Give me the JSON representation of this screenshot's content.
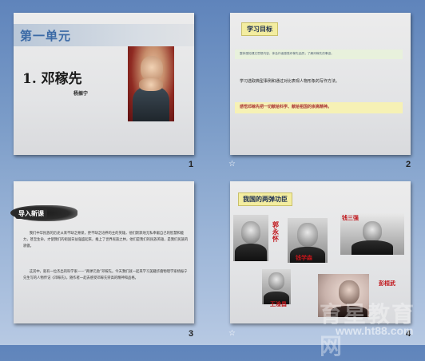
{
  "slides": [
    {
      "number": "1",
      "unit_title": "第一单元",
      "lesson_title": "1. 邓稼先",
      "author": "杨振宁"
    },
    {
      "number": "2",
      "transition_icon": "☆",
      "heading": "学习目标",
      "goals": [
        "整体感知课文思想内容，体会作者感受邓稼先品质；了解邓稼先的事迹。",
        "学习选取典型事例和通过对比表现人物形象的写作方法。",
        "感悟邓稼先把一切献给科学、献给祖国的崇高精神。"
      ]
    },
    {
      "number": "3",
      "heading": "导入新课",
      "paragraphs": [
        "我们中华民族的历史从来不缺乏脊梁，更不缺乏培养的主的英雄，他们默默地无私奉献自己的智慧和能力，甚至生命，才使我们的祖国日益强盛起来，推上了世界民族之林，他们是我们的民族英雄，是我们民族的骄傲。",
        "这其中，就有一位杰出的科学家——“两弹元勋”邓稼先。今天我们就一起来学习美籍华裔物理学家杨振宁先生写的人物传记《邓稼先》，随作者一起去感受邓稼先崇高的精神和品格。"
      ]
    },
    {
      "number": "4",
      "transition_icon": "☆",
      "heading": "我国的两弹功臣",
      "people": [
        "郭永怀",
        "钱学森",
        "钱三强",
        "王淦昌",
        "彭桓武"
      ]
    }
  ],
  "watermark": {
    "site": "育星教育网",
    "url": "www.ht88.com"
  }
}
